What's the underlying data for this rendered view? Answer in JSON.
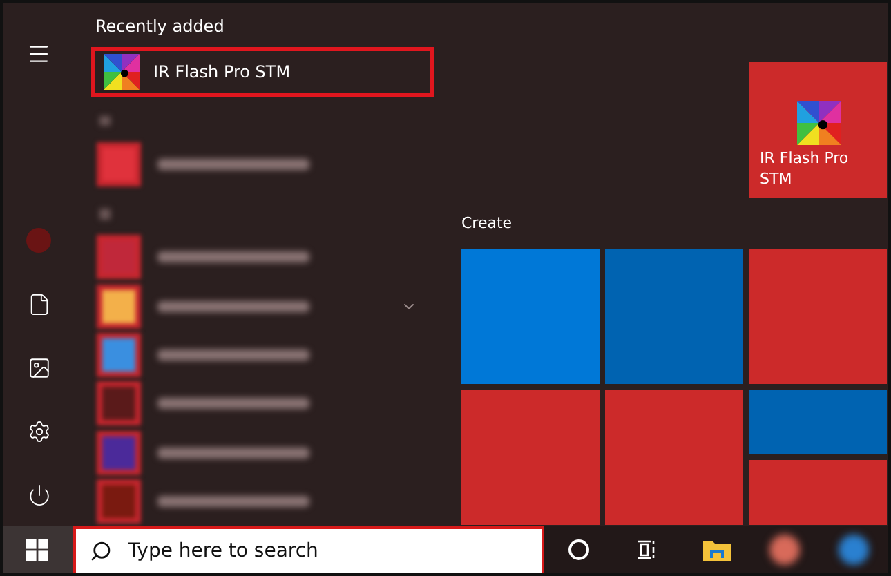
{
  "recently_added": {
    "title": "Recently added",
    "apps": [
      {
        "label": "IR Flash Pro STM",
        "highlighted": true
      }
    ]
  },
  "app_list": [
    {
      "kind": "letter"
    },
    {
      "kind": "app",
      "color": "#e0323c",
      "has_submenu": false
    },
    {
      "kind": "letter"
    },
    {
      "kind": "app",
      "color": "#c0283a",
      "has_submenu": false
    },
    {
      "kind": "app",
      "color": "#f3b04a",
      "has_submenu": true
    },
    {
      "kind": "app",
      "color": "#3a8fe0",
      "has_submenu": false
    },
    {
      "kind": "app",
      "color": "#5a1a1a",
      "has_submenu": false
    },
    {
      "kind": "app",
      "color": "#4b2a9a",
      "has_submenu": false
    },
    {
      "kind": "app",
      "color": "#7a1a10",
      "has_submenu": false
    }
  ],
  "pinned_tile": {
    "label": "IR Flash Pro STM",
    "color": "#cc2a2a"
  },
  "create_group": {
    "title": "Create",
    "tiles": [
      {
        "kind": "medium",
        "color": "#0078d7"
      },
      {
        "kind": "medium",
        "color": "#0063b1"
      },
      {
        "kind": "medium",
        "color": "#cc2a2a"
      },
      {
        "kind": "medium",
        "color": "#cc2a2a"
      },
      {
        "kind": "medium",
        "color": "#cc2a2a"
      },
      {
        "kind": "wide",
        "color": "#0063b1"
      },
      {
        "kind": "wide",
        "color": "#cc2a2a"
      }
    ]
  },
  "taskbar": {
    "search": {
      "placeholder": "Type here to search"
    }
  }
}
